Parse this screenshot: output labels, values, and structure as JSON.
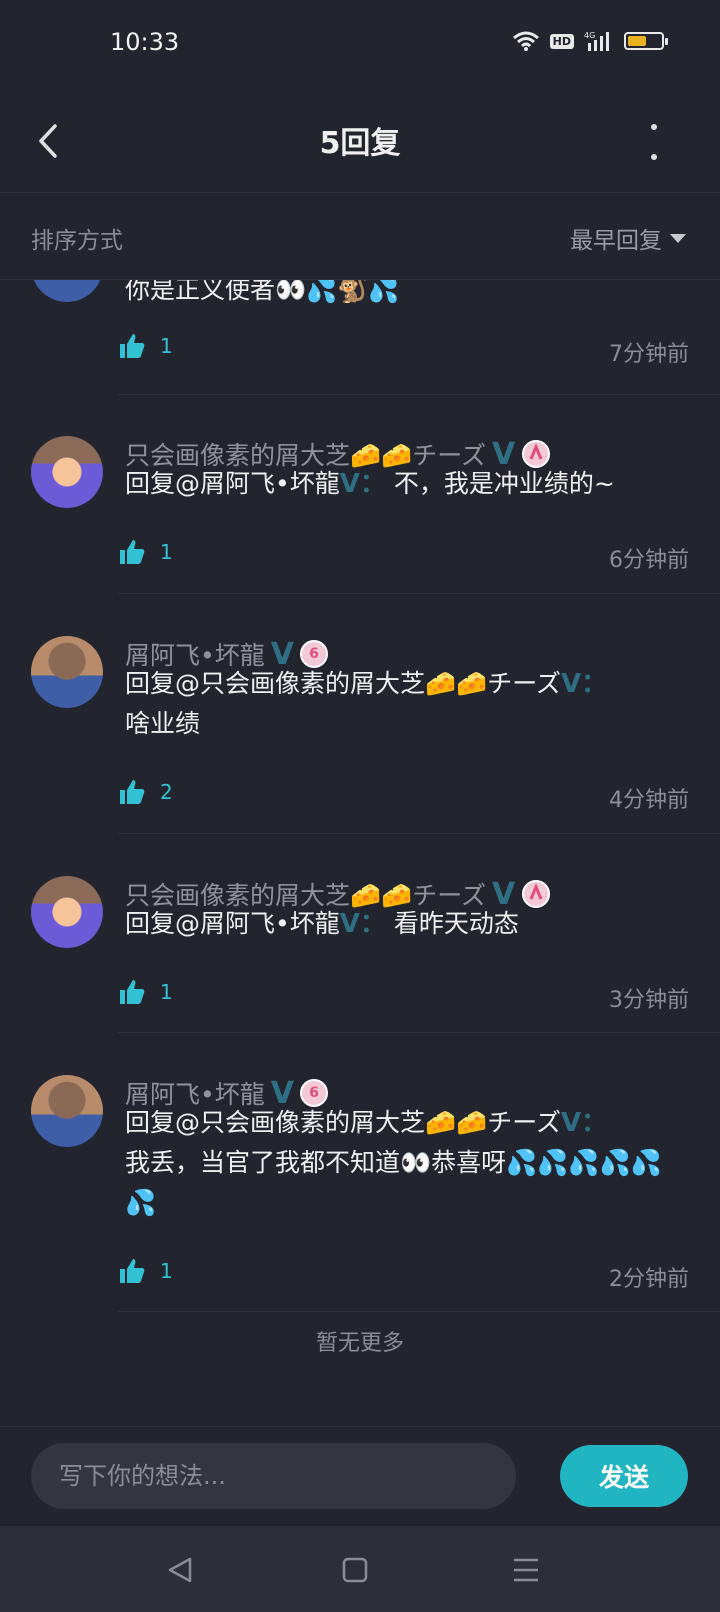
{
  "status": {
    "time": "10:33",
    "hd": "HD",
    "network": "4G",
    "battery_level": 0.55
  },
  "header": {
    "title": "5回复"
  },
  "sort": {
    "label": "排序方式",
    "selected": "最早回复"
  },
  "comments": [
    {
      "name": "",
      "text": "你是正义使者👀💦🐒💦",
      "likes": "1",
      "time": "7分钟前"
    },
    {
      "name": "只会画像素的屑大芝🧀🧀チーズ",
      "verified": "V",
      "text_prefix": "回复@屑阿飞•坏龍",
      "text_sep": "V：",
      "text": "不，我是冲业绩的~",
      "likes": "1",
      "time": "6分钟前"
    },
    {
      "name": "屑阿飞•坏龍",
      "verified": "V",
      "level": "6",
      "text_prefix": "回复@只会画像素的屑大芝🧀🧀チーズ",
      "text_sep": "V：",
      "text": "啥业绩",
      "likes": "2",
      "time": "4分钟前"
    },
    {
      "name": "只会画像素的屑大芝🧀🧀チーズ",
      "verified": "V",
      "text_prefix": "回复@屑阿飞•坏龍",
      "text_sep": "V：",
      "text": "看昨天动态",
      "likes": "1",
      "time": "3分钟前"
    },
    {
      "name": "屑阿飞•坏龍",
      "verified": "V",
      "level": "6",
      "text_prefix": "回复@只会画像素的屑大芝🧀🧀チーズ",
      "text_sep": "V：",
      "text": "我丢，当官了我都不知道👀恭喜呀💦💦💦💦💦💦",
      "likes": "1",
      "time": "2分钟前"
    }
  ],
  "footer": {
    "no_more": "暂无更多"
  },
  "input": {
    "placeholder": "写下你的想法...",
    "send_label": "发送"
  },
  "colors": {
    "accent": "#21b5c2",
    "background": "#23252e",
    "like": "#33c2d4"
  }
}
